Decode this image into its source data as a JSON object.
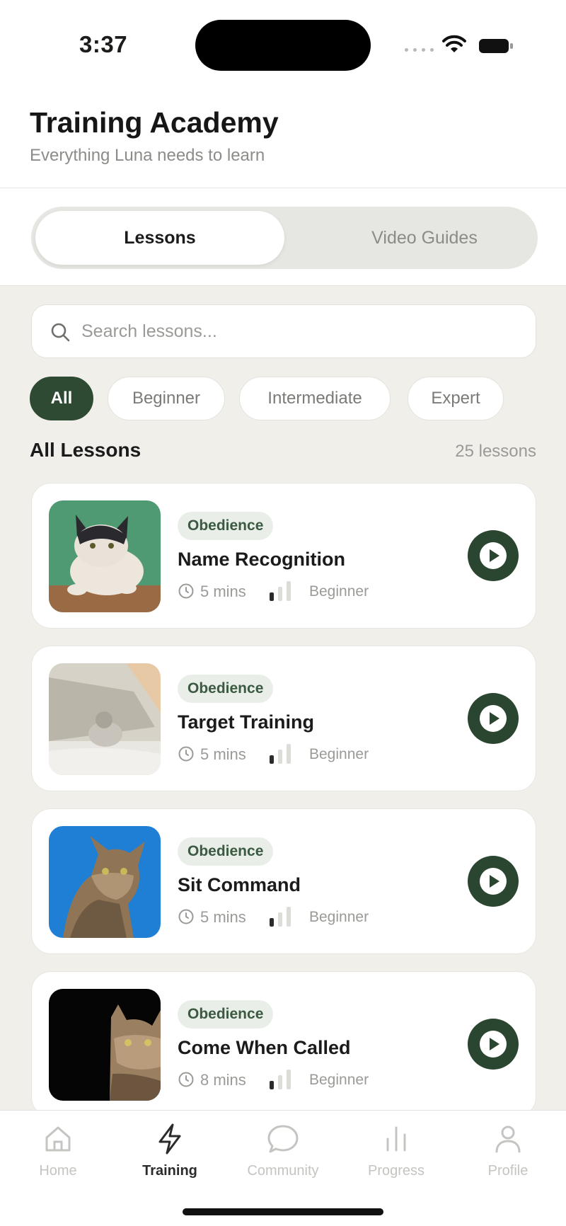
{
  "status_bar": {
    "time": "3:37"
  },
  "header": {
    "title": "Training Academy",
    "subtitle": "Everything Luna needs to learn"
  },
  "segments": {
    "lessons": "Lessons",
    "video_guides": "Video Guides",
    "selected": "Lessons"
  },
  "search": {
    "placeholder": "Search lessons...",
    "value": ""
  },
  "filters": {
    "selected": "All",
    "items": [
      "All",
      "Beginner",
      "Intermediate",
      "Expert"
    ]
  },
  "section": {
    "title": "All Lessons",
    "count": "25 lessons"
  },
  "lessons": [
    {
      "category": "Obedience",
      "title": "Name Recognition",
      "duration": "5 mins",
      "level": "Beginner",
      "thumbnail": "cat-on-green"
    },
    {
      "category": "Obedience",
      "title": "Target Training",
      "duration": "5 mins",
      "level": "Beginner",
      "thumbnail": "cat-by-window"
    },
    {
      "category": "Obedience",
      "title": "Sit Command",
      "duration": "5 mins",
      "level": "Beginner",
      "thumbnail": "tabby-sky"
    },
    {
      "category": "Obedience",
      "title": "Come When Called",
      "duration": "8 mins",
      "level": "Beginner",
      "thumbnail": "cat-peeking-dark"
    }
  ],
  "tab_bar": {
    "selected": "Training",
    "items": [
      {
        "label": "Home",
        "icon": "home-icon"
      },
      {
        "label": "Training",
        "icon": "bolt-icon"
      },
      {
        "label": "Community",
        "icon": "chat-bubble-icon"
      },
      {
        "label": "Progress",
        "icon": "bar-chart-icon"
      },
      {
        "label": "Profile",
        "icon": "person-icon"
      }
    ]
  },
  "colors": {
    "accent": "#2e4a33",
    "background": "#f1efea",
    "tag_background": "#e9efe8",
    "muted_text": "#9a9a96"
  }
}
